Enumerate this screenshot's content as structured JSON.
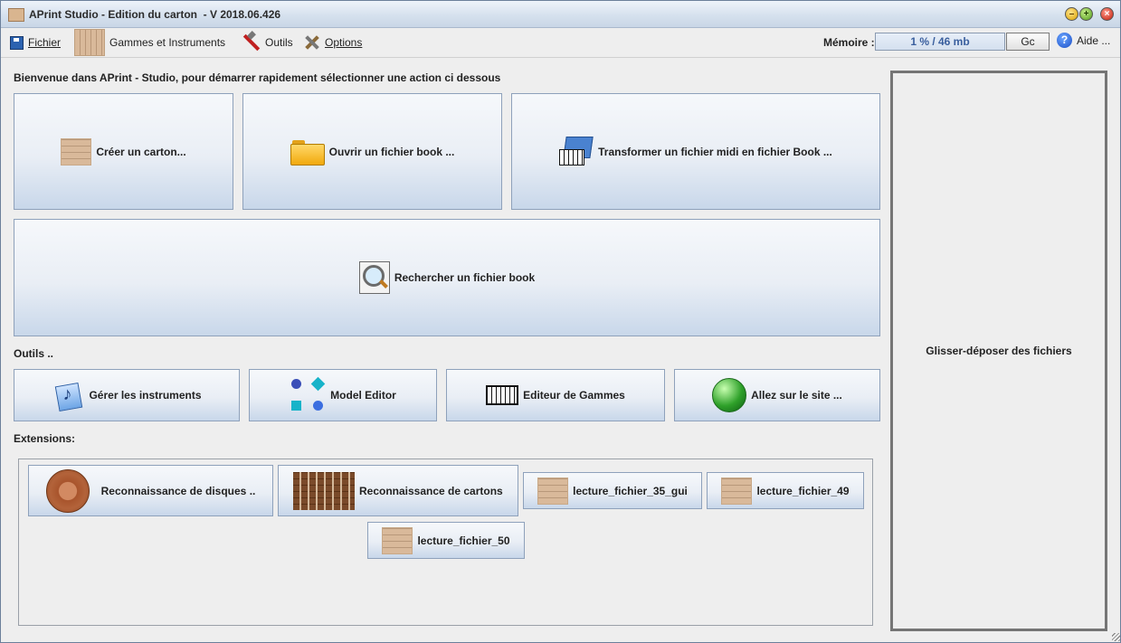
{
  "window": {
    "title": "APrint Studio - Edition du carton  - V 2018.06.426"
  },
  "menubar": {
    "fichier_label": "Fichier",
    "gammes_label": "Gammes et Instruments",
    "outils_label": "Outils",
    "options_label": "Options",
    "memoire_label": "Mémoire :",
    "memoire_value": "1 % / 46 mb",
    "gc_label": "Gc",
    "aide_label": "Aide ..."
  },
  "welcome": {
    "text": "Bienvenue dans APrint - Studio, pour démarrer rapidement sélectionner une action ci dessous",
    "creer": "Créer un carton...",
    "ouvrir": "Ouvrir un fichier book ...",
    "midi": "Transformer un fichier midi en fichier Book ...",
    "rechercher": "Rechercher un fichier book"
  },
  "outils": {
    "label": "Outils ..",
    "instruments": "Gérer les instruments",
    "model_editor": "Model Editor",
    "editeur_gammes": "Editeur de Gammes",
    "site": "Allez sur le site ..."
  },
  "extensions": {
    "label": "Extensions:",
    "items": [
      {
        "label": "Reconnaissance de disques .."
      },
      {
        "label": "Reconnaissance de cartons"
      },
      {
        "label": "lecture_fichier_35_gui"
      },
      {
        "label": "lecture_fichier_49"
      },
      {
        "label": "lecture_fichier_50"
      }
    ]
  },
  "drop_zone": {
    "label": "Glisser-déposer des fichiers"
  },
  "icons": {
    "app": "carton-icon",
    "fichier": "floppy-disk-icon",
    "gammes": "carton-icon",
    "outils": "tools-icon",
    "options": "options-icon",
    "aide": "help-icon",
    "ouvrir": "folder-icon",
    "midi": "midi-file-icon",
    "rechercher": "search-icon",
    "instruments": "instrument-icon",
    "model_editor": "model-editor-icon",
    "editeur_gammes": "piano-keys-icon",
    "site": "globe-icon",
    "disques": "disc-icon"
  },
  "colors": {
    "accent_button_gradient_top": "#f6f8fb",
    "accent_button_gradient_bottom": "#c8d7ea",
    "memory_text": "#3a5f9e"
  }
}
